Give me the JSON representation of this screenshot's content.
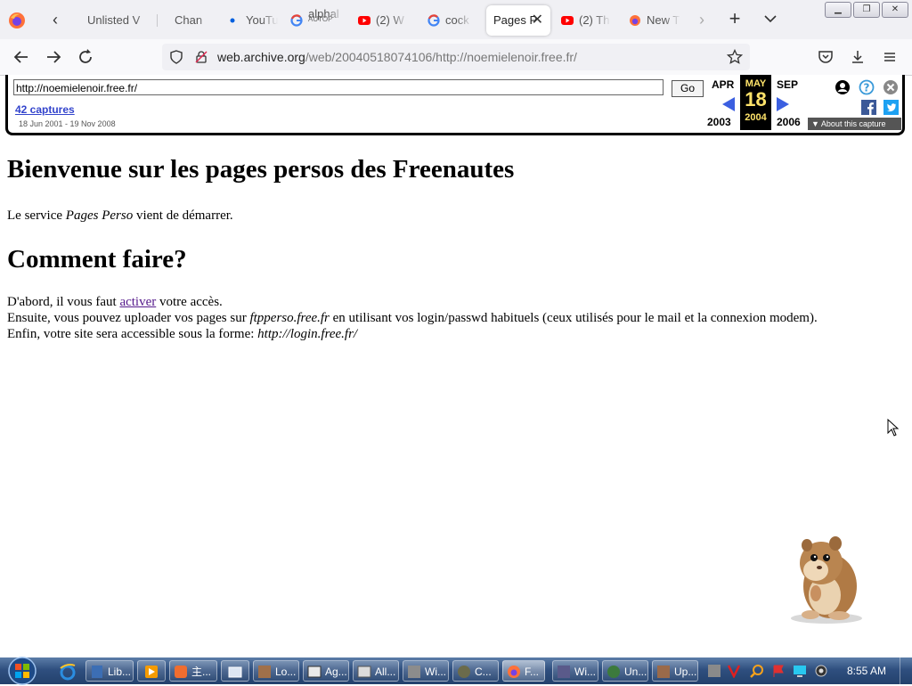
{
  "browser": {
    "tabs": [
      {
        "label": "Unlisted V",
        "sub": "",
        "icon": "video-icon"
      },
      {
        "label": "Chan",
        "sub": "",
        "icon": "blank-icon"
      },
      {
        "label": "YouTu",
        "sub": "",
        "icon": "dot-icon"
      },
      {
        "label": "alphal",
        "sub": "AUTOP",
        "icon": "google-icon"
      },
      {
        "label": "(2) W",
        "sub": "",
        "icon": "youtube-icon"
      },
      {
        "label": "cock",
        "sub": "",
        "icon": "google-icon"
      },
      {
        "label": "Pages P",
        "sub": "",
        "icon": "none",
        "active": true
      },
      {
        "label": "(2) Th",
        "sub": "",
        "icon": "youtube-icon"
      },
      {
        "label": "New T",
        "sub": "",
        "icon": "firefox-icon"
      }
    ],
    "url_domain": "web.archive.org",
    "url_path": "/web/20040518074106/http://noemielenoir.free.fr/",
    "colors": {
      "youtube_red": "#ff0000",
      "accent": "#0060df"
    }
  },
  "wayback": {
    "url_value": "http://noemielenoir.free.fr/",
    "go_label": "Go",
    "captures_label": "42 captures",
    "date_range": "18 Jun 2001 - 19 Nov 2008",
    "prev_month": "APR",
    "prev_year": "2003",
    "cur_month": "MAY",
    "cur_day": "18",
    "cur_year": "2004",
    "next_month": "SEP",
    "next_year": "2006",
    "about_label": "About this capture"
  },
  "page": {
    "heading1": "Bienvenue sur les pages persos des Freenautes",
    "intro_before": "Le service ",
    "intro_em": "Pages Perso",
    "intro_after": " vient de démarrer.",
    "heading2": "Comment faire?",
    "line1_before": "D'abord, il vous faut ",
    "line1_link": "activer",
    "line1_after": " votre accès.",
    "line2_before": "Ensuite, vous pouvez uploader vos pages sur ",
    "line2_em": "ftpperso.free.fr",
    "line2_after": " en utilisant vos login/passwd habituels (ceux utilisés pour le mail et la connexion modem).",
    "line3_before": "Enfin, votre site sera accessible sous la forme: ",
    "line3_em": "http://login.free.fr/"
  },
  "taskbar": {
    "tasks": [
      {
        "label": "Lib..."
      },
      {
        "label": ""
      },
      {
        "label": "主..."
      },
      {
        "label": ""
      },
      {
        "label": "Lo..."
      },
      {
        "label": "Ag..."
      },
      {
        "label": "All..."
      },
      {
        "label": "Wi..."
      },
      {
        "label": "C..."
      },
      {
        "label": "F..."
      },
      {
        "label": "Wi..."
      },
      {
        "label": "Un..."
      },
      {
        "label": "Up..."
      }
    ],
    "clock": "8:55 AM"
  }
}
